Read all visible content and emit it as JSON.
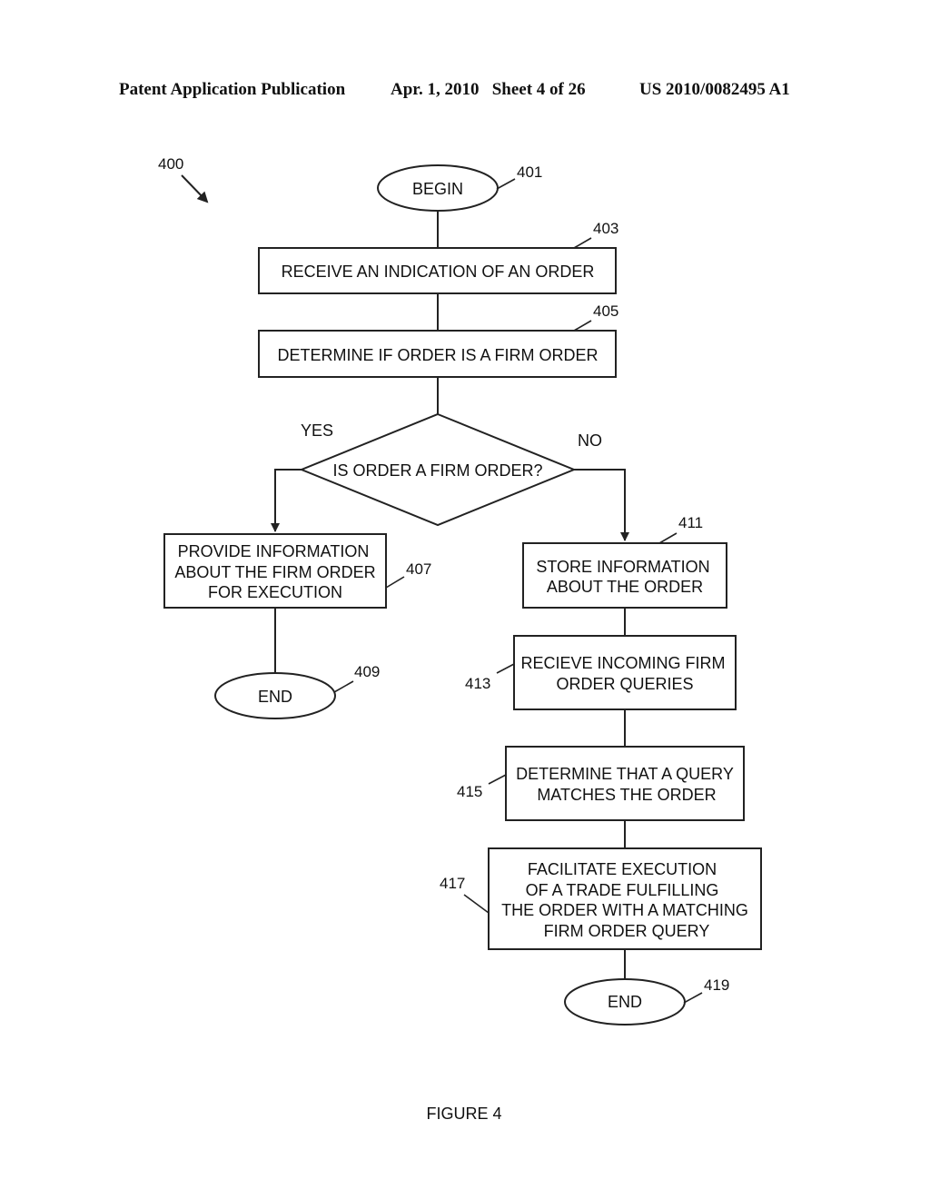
{
  "header": {
    "publication": "Patent Application Publication",
    "date_sheet": "Apr. 1, 2010   Sheet 4 of 26",
    "patent_number": "US 2010/0082495 A1"
  },
  "figure": {
    "ref": "400",
    "caption": "FIGURE 4"
  },
  "nodes": {
    "begin": {
      "ref": "401",
      "lines": [
        "BEGIN"
      ]
    },
    "receive": {
      "ref": "403",
      "lines": [
        "RECEIVE AN INDICATION OF AN ORDER"
      ]
    },
    "determine": {
      "ref": "405",
      "lines": [
        "DETERMINE IF ORDER IS A FIRM ORDER"
      ]
    },
    "decision": {
      "lines": [
        "IS ORDER A FIRM ORDER?"
      ],
      "yes_label": "YES",
      "no_label": "NO"
    },
    "provide": {
      "ref": "407",
      "lines": [
        "PROVIDE INFORMATION",
        "ABOUT THE FIRM ORDER",
        "FOR EXECUTION"
      ]
    },
    "end_left": {
      "ref": "409",
      "lines": [
        "END"
      ]
    },
    "store": {
      "ref": "411",
      "lines": [
        "STORE INFORMATION",
        "ABOUT THE ORDER"
      ]
    },
    "recieve_queries": {
      "ref": "413",
      "lines": [
        "RECIEVE INCOMING FIRM",
        "ORDER QUERIES"
      ]
    },
    "match": {
      "ref": "415",
      "lines": [
        "DETERMINE THAT A QUERY",
        "MATCHES THE ORDER"
      ]
    },
    "facilitate": {
      "ref": "417",
      "lines": [
        "FACILITATE EXECUTION",
        "OF A TRADE FULFILLING",
        "THE ORDER WITH A MATCHING",
        "FIRM ORDER QUERY"
      ]
    },
    "end_right": {
      "ref": "419",
      "lines": [
        "END"
      ]
    }
  }
}
